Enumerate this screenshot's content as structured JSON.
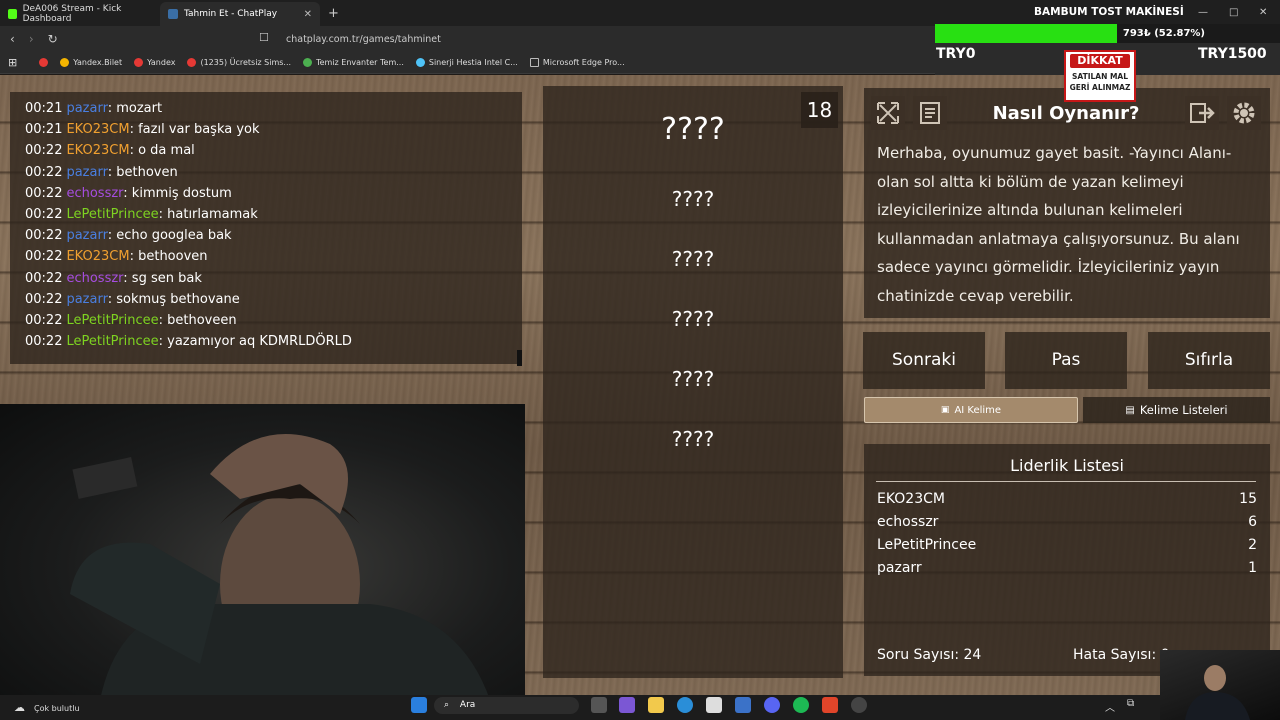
{
  "browser": {
    "tabs": [
      {
        "label": "DeA006 Stream - Kick Dashboard",
        "color": "#53fc18"
      },
      {
        "label": "Tahmin Et - ChatPlay",
        "color": "#3a6ea5"
      }
    ],
    "new_tab": "+",
    "url": "chatplay.com.tr/games/tahminet",
    "bookmarks": [
      {
        "label": "Yandex.Bilet",
        "color": "#f4b400"
      },
      {
        "label": "Yandex",
        "color": "#e53935"
      },
      {
        "label": "(1235) Ücretsiz Sims...",
        "color": "#e53935"
      },
      {
        "label": "Temiz Envanter Tem...",
        "color": "#4caf50"
      },
      {
        "label": "Sinerji Hestia Intel C...",
        "color": "#4fc3f7"
      },
      {
        "label": "Microsoft Edge Pro...",
        "color": "#bbbbbb"
      }
    ]
  },
  "overlay": {
    "title": "BAMBUM TOST MAKİNESİ",
    "progress_text": "793₺ (52.87%)",
    "progress": 0.5287,
    "min": "TRY0",
    "max": "TRY1500",
    "dikkat_title": "DİKKAT",
    "dikkat_l1": "SATILAN MAL",
    "dikkat_l2": "GERİ ALINMAZ"
  },
  "chat": {
    "messages": [
      {
        "time": "00:21",
        "user": "pazarr",
        "color": "#4a7fe0",
        "text": ": mozart"
      },
      {
        "time": "00:21",
        "user": "EKO23CM",
        "color": "#f0a030",
        "text": ": fazıl var başka yok"
      },
      {
        "time": "00:22",
        "user": "EKO23CM",
        "color": "#f0a030",
        "text": ": o da mal"
      },
      {
        "time": "00:22",
        "user": "pazarr",
        "color": "#4a7fe0",
        "text": ": bethoven"
      },
      {
        "time": "00:22",
        "user": "echosszr",
        "color": "#a64de0",
        "text": ": kimmiş dostum"
      },
      {
        "time": "00:22",
        "user": "LePetitPrincee",
        "color": "#7ed321",
        "text": ": hatırlamamak"
      },
      {
        "time": "00:22",
        "user": "pazarr",
        "color": "#4a7fe0",
        "text": ": echo googlea bak"
      },
      {
        "time": "00:22",
        "user": "EKO23CM",
        "color": "#f0a030",
        "text": ": bethooven"
      },
      {
        "time": "00:22",
        "user": "echosszr",
        "color": "#a64de0",
        "text": ": sg sen bak"
      },
      {
        "time": "00:22",
        "user": "pazarr",
        "color": "#4a7fe0",
        "text": ": sokmuş bethovane"
      },
      {
        "time": "00:22",
        "user": "LePetitPrincee",
        "color": "#7ed321",
        "text": ": bethoveen"
      },
      {
        "time": "00:22",
        "user": "LePetitPrincee",
        "color": "#7ed321",
        "text": ": yazamıyor aq KDMRLDÖRLD"
      }
    ]
  },
  "game": {
    "counter": "18",
    "words": [
      "????",
      "????",
      "????",
      "????",
      "????",
      "????"
    ],
    "howto_title": "Nasıl Oynanır?",
    "howto_text": "Merhaba, oyunumuz gayet basit. -Yayıncı Alanı- olan sol altta ki bölüm de yazan kelimeyi izleyicilerinize altında bulunan kelimeleri kullanmadan anlatmaya çalışıyorsunuz. Bu alanı sadece yayıncı görmelidir. İzleyicileriniz yayın chatinizde cevap verebilir.",
    "buttons": {
      "next": "Sonraki",
      "pass": "Pas",
      "reset": "Sıfırla"
    },
    "ai_word": "AI Kelime",
    "word_lists": "Kelime Listeleri",
    "leaderboard_title": "Liderlik Listesi",
    "leaderboard": [
      {
        "name": "EKO23CM",
        "score": "15"
      },
      {
        "name": "echosszr",
        "score": "6"
      },
      {
        "name": "LePetitPrincee",
        "score": "2"
      },
      {
        "name": "pazarr",
        "score": "1"
      }
    ],
    "question_count": "Soru Sayısı: 24",
    "error_count": "Hata Sayısı: 0"
  },
  "taskbar": {
    "weather": "Çok bulutlu",
    "search": "Ara"
  }
}
